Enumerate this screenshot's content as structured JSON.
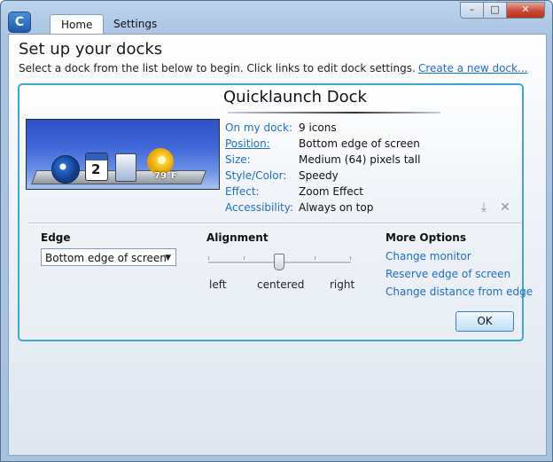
{
  "window": {
    "tabs": [
      {
        "label": "Home",
        "active": true
      },
      {
        "label": "Settings",
        "active": false
      }
    ],
    "controls": {
      "minimize": "–",
      "maximize": "□",
      "close": "✕"
    },
    "app_icon_glyph": "C"
  },
  "page": {
    "heading": "Set up your docks",
    "intro": "Select a dock from the list below to begin. Click links to edit dock settings.",
    "create_link": "Create a new dock..."
  },
  "dock": {
    "name": "Quicklaunch Dock",
    "preview": {
      "calendar_day": "2",
      "weather_temp": "79°F"
    },
    "properties": [
      {
        "label": "On my dock:",
        "value": "9 icons",
        "underlined": false
      },
      {
        "label": "Position:",
        "value": "Bottom edge of screen",
        "underlined": true
      },
      {
        "label": "Size:",
        "value": "Medium (64) pixels tall",
        "underlined": false
      },
      {
        "label": "Style/Color:",
        "value": "Speedy",
        "underlined": false
      },
      {
        "label": "Effect:",
        "value": "Zoom Effect",
        "underlined": false
      },
      {
        "label": "Accessibility:",
        "value": "Always on top",
        "underlined": false
      }
    ],
    "icons": {
      "download": "download-icon",
      "delete": "delete-icon"
    }
  },
  "edge": {
    "label": "Edge",
    "selected": "Bottom edge of screen",
    "arrow": "▼"
  },
  "alignment": {
    "label": "Alignment",
    "left": "left",
    "center": "centered",
    "right": "right",
    "value": 0.5
  },
  "more_options": {
    "label": "More Options",
    "links": [
      "Change monitor",
      "Reserve edge of screen",
      "Change distance from edge"
    ]
  },
  "ok_label": "OK",
  "colors": {
    "accent": "#3aa9d8",
    "link": "#1d6fcb"
  }
}
